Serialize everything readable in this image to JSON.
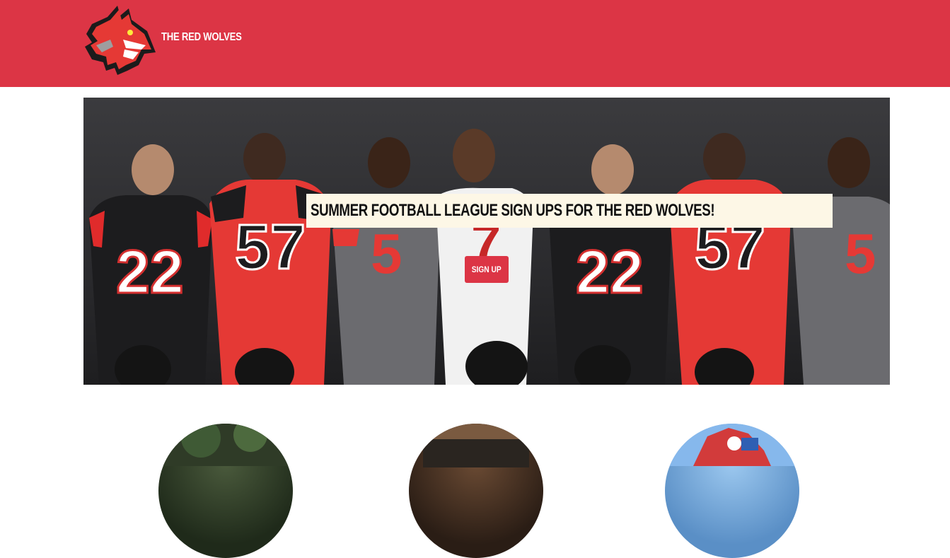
{
  "header": {
    "brand_name": "THE RED WOLVES",
    "logo_icon": "red-wolf-logo-icon",
    "background_color": "#dc3545"
  },
  "hero": {
    "title": "SUMMER FOOTBALL LEAGUE SIGN UPS FOR THE RED WOLVES!",
    "button_label": "SIGN UP",
    "image": "football-players-team-photo"
  },
  "features": [
    {
      "image": "outdoor-scene-photo"
    },
    {
      "image": "indoor-scene-photo"
    },
    {
      "image": "mascot-outdoor-photo"
    }
  ]
}
